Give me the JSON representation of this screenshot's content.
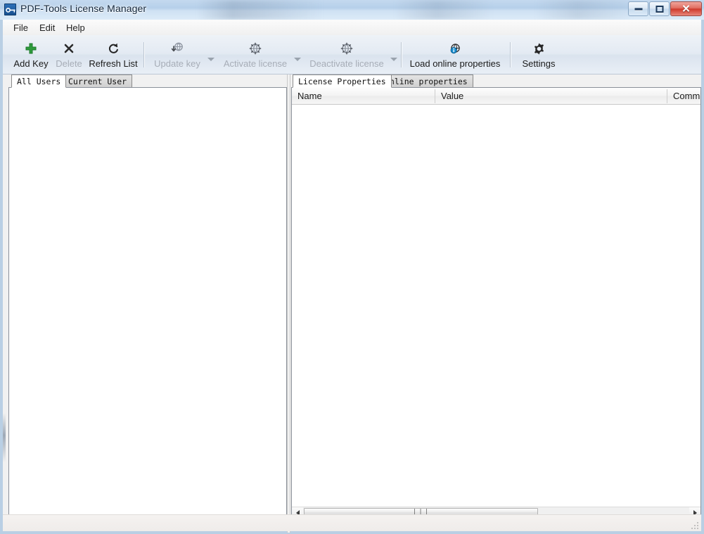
{
  "window": {
    "title": "PDF-Tools License Manager",
    "app_icon": "key-icon",
    "controls": {
      "minimize": "minimize-button",
      "restore": "restore-button",
      "close": "close-button",
      "close_glyph": "✕"
    }
  },
  "menubar": {
    "items": [
      {
        "label": "File"
      },
      {
        "label": "Edit"
      },
      {
        "label": "Help"
      }
    ]
  },
  "toolbar": {
    "buttons": [
      {
        "label": "Add Key",
        "icon": "plus-icon",
        "enabled": true,
        "dropdown": false
      },
      {
        "label": "Delete",
        "icon": "cross-icon",
        "enabled": false,
        "dropdown": false
      },
      {
        "label": "Refresh List",
        "icon": "refresh-icon",
        "enabled": true,
        "dropdown": false
      },
      {
        "label": "Update key",
        "icon": "globe-download-icon",
        "enabled": false,
        "dropdown": true
      },
      {
        "label": "Activate license",
        "icon": "globe-gear-icon",
        "enabled": false,
        "dropdown": true
      },
      {
        "label": "Deactivate license",
        "icon": "globe-gear-icon",
        "enabled": false,
        "dropdown": true
      },
      {
        "label": "Load online properties",
        "icon": "globe-info-icon",
        "enabled": true,
        "dropdown": false
      },
      {
        "label": "Settings",
        "icon": "gear-icon",
        "enabled": true,
        "dropdown": false
      }
    ]
  },
  "left_pane": {
    "tabs": [
      {
        "label": "All Users",
        "active": true
      },
      {
        "label": "Current User",
        "active": false
      }
    ],
    "list_items": []
  },
  "right_pane": {
    "tabs": [
      {
        "label": "License Properties",
        "active": true
      },
      {
        "label": "Online properties",
        "active": false
      }
    ],
    "columns": [
      {
        "label": "Name"
      },
      {
        "label": "Value"
      },
      {
        "label": "Comm"
      }
    ],
    "rows": [],
    "scrollbar": {
      "left_arrow": "◀",
      "right_arrow": "▶",
      "grip": "❘❘❘"
    }
  },
  "statusbar": {
    "text": ""
  },
  "colors": {
    "titlebar": "#b6d0ea",
    "toolbar": "#e3eaf3",
    "accent_green": "#2e9b3c",
    "accent_blue": "#1a8fd0",
    "close_red": "#cf3a2c",
    "disabled_text": "#a7adb7"
  }
}
